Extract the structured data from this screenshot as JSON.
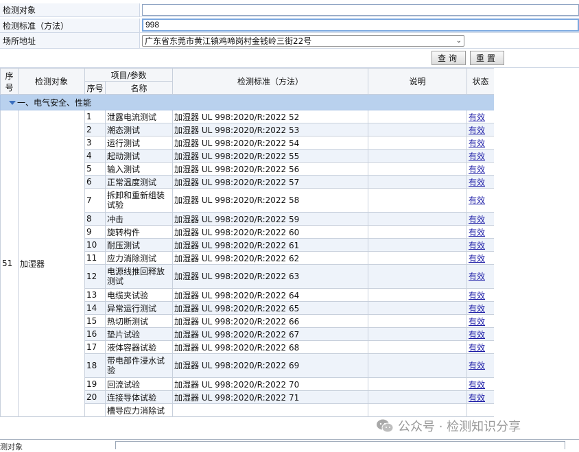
{
  "form": {
    "object_label": "检测对象",
    "object_value": "",
    "standard_label": "检测标准（方法）",
    "standard_value": "998",
    "location_label": "场所地址",
    "location_value": "广东省东莞市黄江镇鸡啼岗村金钱岭三街22号",
    "query_button": "查询",
    "reset_button": "重置"
  },
  "table": {
    "headers": {
      "seq": "序号",
      "object": "检测对象",
      "item_group": "项目/参数",
      "item_seq": "序号",
      "item_name": "名称",
      "standard": "检测标准（方法）",
      "note": "说明",
      "status": "状态"
    },
    "category": "一、电气安全、性能",
    "group_seq": "51",
    "group_object": "加湿器",
    "rows": [
      {
        "no": "1",
        "name": "泄露电流测试",
        "standard": "加湿器 UL 998:2020/R:2022 52",
        "note": "",
        "status": "有效"
      },
      {
        "no": "2",
        "name": "潮态测试",
        "standard": "加湿器 UL 998:2020/R:2022 53",
        "note": "",
        "status": "有效"
      },
      {
        "no": "3",
        "name": "运行测试",
        "standard": "加湿器 UL 998:2020/R:2022 54",
        "note": "",
        "status": "有效"
      },
      {
        "no": "4",
        "name": "起动测试",
        "standard": "加湿器 UL 998:2020/R:2022 55",
        "note": "",
        "status": "有效"
      },
      {
        "no": "5",
        "name": "输入测试",
        "standard": "加湿器 UL 998:2020/R:2022 56",
        "note": "",
        "status": "有效"
      },
      {
        "no": "6",
        "name": "正常温度测试",
        "standard": "加湿器 UL 998:2020/R:2022 57",
        "note": "",
        "status": "有效"
      },
      {
        "no": "7",
        "name": "拆卸和重新组装试验",
        "standard": "加湿器 UL 998:2020/R:2022 58",
        "note": "",
        "status": "有效"
      },
      {
        "no": "8",
        "name": "冲击",
        "standard": "加湿器 UL 998:2020/R:2022 59",
        "note": "",
        "status": "有效"
      },
      {
        "no": "9",
        "name": "旋转构件",
        "standard": "加湿器 UL 998:2020/R:2022 60",
        "note": "",
        "status": "有效"
      },
      {
        "no": "10",
        "name": "耐压测试",
        "standard": "加湿器 UL 998:2020/R:2022 61",
        "note": "",
        "status": "有效"
      },
      {
        "no": "11",
        "name": "应力消除测试",
        "standard": "加湿器 UL 998:2020/R:2022 62",
        "note": "",
        "status": "有效"
      },
      {
        "no": "12",
        "name": "电源线推回释放测试",
        "standard": "加湿器 UL 998:2020/R:2022 63",
        "note": "",
        "status": "有效"
      },
      {
        "no": "13",
        "name": "电缆夹试验",
        "standard": "加湿器 UL 998:2020/R:2022 64",
        "note": "",
        "status": "有效"
      },
      {
        "no": "14",
        "name": "异常运行测试",
        "standard": "加湿器 UL 998:2020/R:2022 65",
        "note": "",
        "status": "有效"
      },
      {
        "no": "15",
        "name": "热切断测试",
        "standard": "加湿器 UL 998:2020/R:2022 66",
        "note": "",
        "status": "有效"
      },
      {
        "no": "16",
        "name": "垫片试验",
        "standard": "加湿器 UL 998:2020/R:2022 67",
        "note": "",
        "status": "有效"
      },
      {
        "no": "17",
        "name": "液体容器试验",
        "standard": "加湿器 UL 998:2020/R:2022 68",
        "note": "",
        "status": "有效"
      },
      {
        "no": "18",
        "name": "带电部件浸水试验",
        "standard": "加湿器 UL 998:2020/R:2022 69",
        "note": "",
        "status": "有效"
      },
      {
        "no": "19",
        "name": "回流试验",
        "standard": "加湿器 UL 998:2020/R:2022 70",
        "note": "",
        "status": "有效"
      },
      {
        "no": "20",
        "name": "连接导体试验",
        "standard": "加湿器 UL 998:2020/R:2022 71",
        "note": "",
        "status": "有效"
      },
      {
        "no": "",
        "name": "槽导应力消除试",
        "standard": "",
        "note": "",
        "status": ""
      }
    ]
  },
  "bottom": {
    "label": "测对象"
  },
  "watermark": {
    "text": "公众号 · 检测知识分享",
    "icon": "wechat-icon"
  },
  "colors": {
    "category_bg": "#b9d1ee",
    "link": "#1a1aa6",
    "row_alt": "#eef3fa"
  }
}
